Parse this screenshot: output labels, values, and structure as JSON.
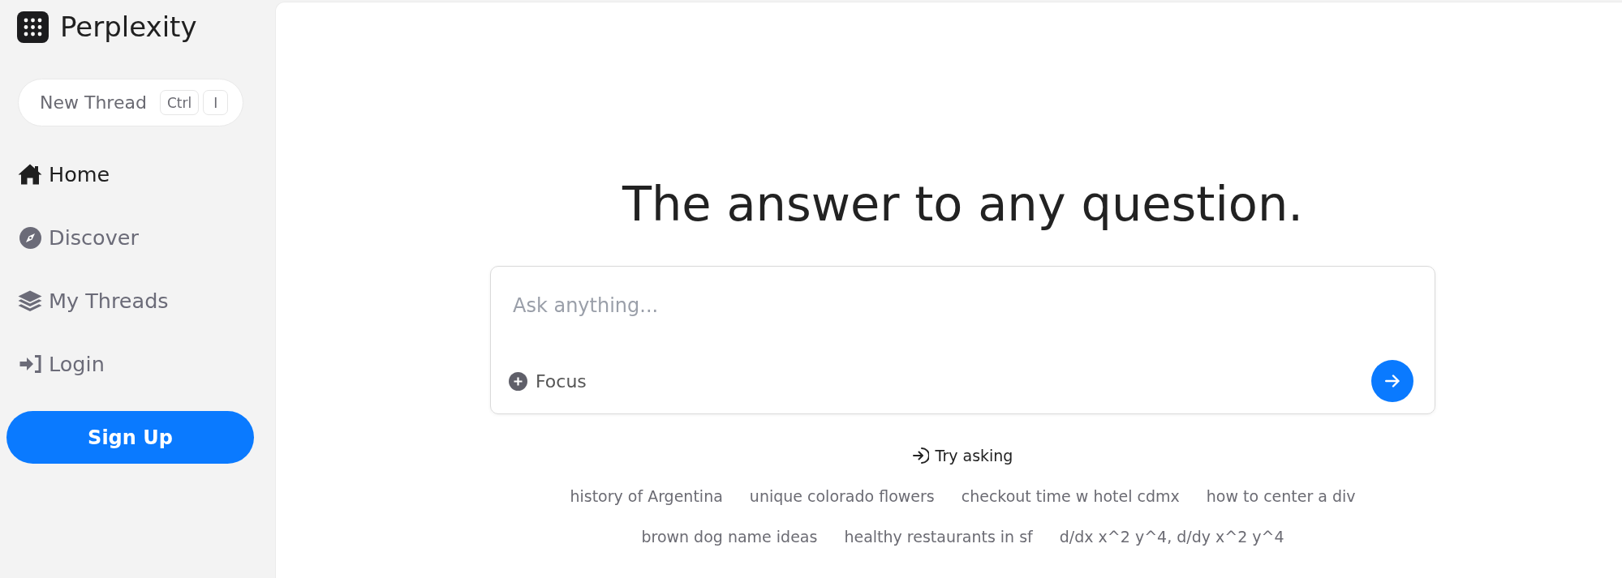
{
  "sidebar": {
    "brand": "Perplexity",
    "new_thread": {
      "label": "New Thread",
      "shortcut": [
        "Ctrl",
        "I"
      ]
    },
    "nav_items": [
      {
        "label": "Home",
        "selected": true
      },
      {
        "label": "Discover",
        "selected": false
      },
      {
        "label": "My Threads",
        "selected": false
      },
      {
        "label": "Login",
        "selected": false
      }
    ],
    "sign_up": "Sign Up"
  },
  "main": {
    "heading": "The answer to any question.",
    "search": {
      "placeholder": "Ask anything...",
      "focus": "Focus"
    },
    "try_asking": "Try asking",
    "suggestion_rows": [
      [
        "history of Argentina",
        "unique colorado flowers",
        "checkout time w hotel cdmx",
        "how to center a div"
      ],
      [
        "brown dog name ideas",
        "healthy restaurants in sf",
        "d/dx x^2 y^4, d/dy x^2 y^4"
      ]
    ]
  }
}
